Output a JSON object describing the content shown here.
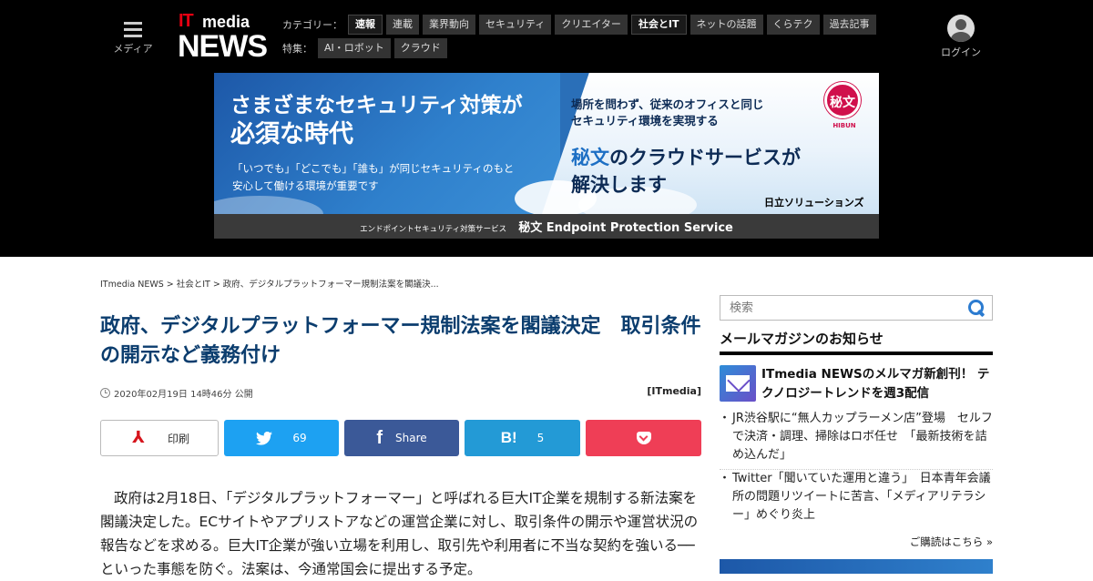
{
  "header": {
    "menu_label": "メディア",
    "logo_it": "IT",
    "logo_media": "media",
    "logo_news": "NEWS",
    "category_label": "カテゴリー：",
    "categories": [
      {
        "label": "速報",
        "active": true
      },
      {
        "label": "連載",
        "active": false
      },
      {
        "label": "業界動向",
        "active": false
      },
      {
        "label": "セキュリティ",
        "active": false
      },
      {
        "label": "クリエイター",
        "active": false
      },
      {
        "label": "社会とIT",
        "active": true
      },
      {
        "label": "ネットの話題",
        "active": false
      },
      {
        "label": "くらテク",
        "active": false
      },
      {
        "label": "過去記事",
        "active": false
      }
    ],
    "special_label": "特集：",
    "specials": [
      {
        "label": "AI・ロボット"
      },
      {
        "label": "クラウド"
      }
    ],
    "login_label": "ログイン"
  },
  "banner": {
    "headline_1": "さまざまなセキュリティ対策が",
    "headline_2": "必須な時代",
    "sub_1": "「いつでも」「どこでも」「誰も」が同じセキュリティのもと",
    "sub_2": "安心して働ける環境が重要です",
    "right_top_1": "場所を問わず、従来のオフィスと同じ",
    "right_top_2": "セキュリティ環境を実現する",
    "right_main_hl": "秘文",
    "right_main_1": "のクラウドサービスが",
    "right_main_2": "解決します",
    "badge": "秘文",
    "badge_label": "HIBUN",
    "brand": "日立ソリューションズ",
    "bottom_small": "エンドポイントセキュリティ対策サービス",
    "bottom_large": "秘文 Endpoint Protection Service"
  },
  "article": {
    "breadcrumb": [
      "ITmedia NEWS",
      "社会とIT",
      "政府、デジタルプラットフォーマー規制法案を閣議決..."
    ],
    "title": "政府、デジタルプラットフォーマー規制法案を閣議決定　取引条件の開示など義務付け",
    "date": "2020年02月19日 14時46分 公開",
    "source": "[ITmedia]",
    "share": {
      "print": "印刷",
      "twitter_count": "69",
      "facebook": "Share",
      "hatena_icon": "B!",
      "hatena_count": "5"
    },
    "body": "政府は2月18日、「デジタルプラットフォーマー」と呼ばれる巨大IT企業を規制する新法案を閣議決定した。ECサイトやアプリストアなどの運営企業に対し、取引条件の開示や運営状況の報告などを求める。巨大IT企業が強い立場を利用し、取引先や利用者に不当な契約を強いる──といった事態を防ぐ。法案は、今通常国会に提出する予定。"
  },
  "sidebar": {
    "search_placeholder": "検索",
    "newsletter_title": "メールマガジンのお知らせ",
    "featured": "ITmedia NEWSのメルマガ新創刊！ テクノロジートレンドを週3配信",
    "items": [
      "JR渋谷駅に“無人カップラーメン店”登場　セルフで決済・調理、掃除はロボ任せ　「最新技術を詰め込んだ」",
      "Twitter「聞いていた運用と違う」　日本青年会議所の問題リツイートに苦言、「メディアリテラシー」めぐり炎上"
    ],
    "more": "ご購読はこちら »"
  },
  "colors": {
    "header_bg": "#000000",
    "headline": "#0b3d6e",
    "twitter": "#1da1f2",
    "facebook": "#3b5998",
    "hatena": "#239ad6",
    "pocket": "#ef3e56",
    "logo_red": "#e60012"
  }
}
